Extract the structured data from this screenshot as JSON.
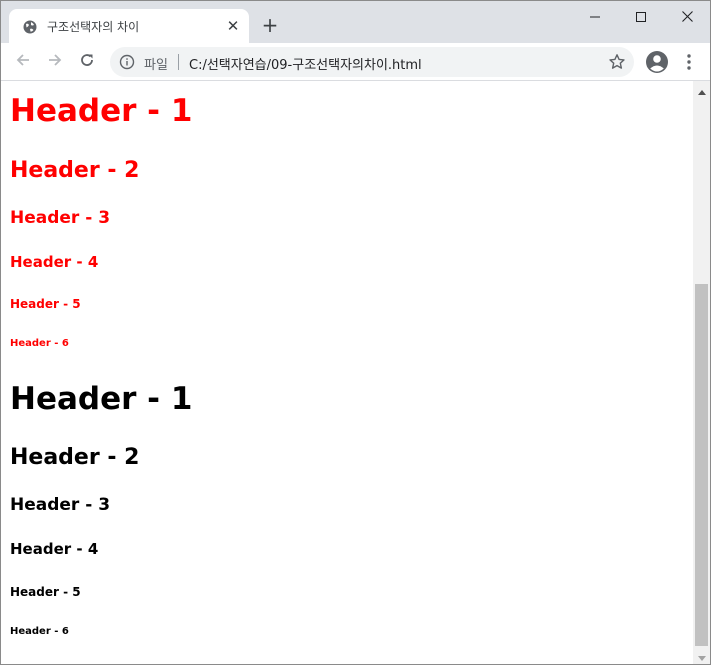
{
  "window": {
    "tab_title": "구조선택자의 차이",
    "close_tab_label": "✕",
    "new_tab_label": "+"
  },
  "toolbar": {
    "security_label": "파일",
    "url": "C:/선택자연습/09-구조선택자의차이.html"
  },
  "page": {
    "red_headers": {
      "h1": "Header - 1",
      "h2": "Header - 2",
      "h3": "Header - 3",
      "h4": "Header - 4",
      "h5": "Header - 5",
      "h6": "Header - 6"
    },
    "black_headers": {
      "h1": "Header - 1",
      "h2": "Header - 2",
      "h3": "Header - 3",
      "h4": "Header - 4",
      "h5": "Header - 5",
      "h6": "Header - 6"
    },
    "colors": {
      "first_group": "#ff0000",
      "second_group": "#000000"
    }
  },
  "icons": {
    "favicon": "globe-icon",
    "back": "arrow-left-icon",
    "forward": "arrow-right-icon",
    "reload": "reload-icon",
    "info": "info-icon",
    "bookmark": "star-icon",
    "profile": "account-icon",
    "menu": "kebab-menu-icon",
    "minimize": "minimize-icon",
    "maximize": "maximize-icon",
    "close": "close-icon"
  }
}
